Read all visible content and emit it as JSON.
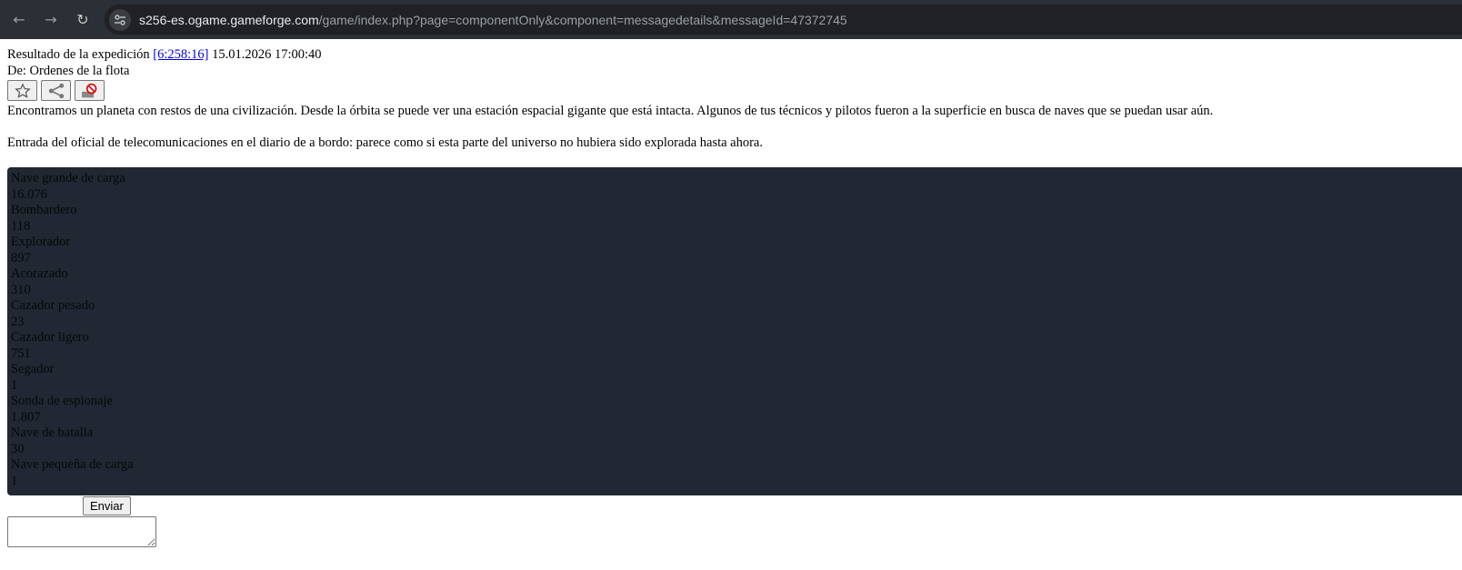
{
  "browser": {
    "url_host": "s256-es.ogame.gameforge.com",
    "url_path": "/game/index.php?page=componentOnly&component=messagedetails&messageId=47372745"
  },
  "message": {
    "title_prefix": "Resultado de la expedición",
    "coords": "[6:258:16]",
    "datetime": "15.01.2026 17:00:40",
    "from": "De: Ordenes de la flota",
    "paragraph1": "Encontramos un planeta con restos de una civilización. Desde la órbita se puede ver una estación espacial gigante que está intacta. Algunos de tus técnicos y pilotos fueron a la superficie en busca de naves que se puedan usar aún.",
    "paragraph2": "Entrada del oficial de telecomunicaciones en el diario de a bordo: parece como si esta parte del universo no hubiera sido explorada hasta ahora."
  },
  "ships": [
    {
      "name": "Nave grande de carga",
      "count": "16.076"
    },
    {
      "name": "Bombardero",
      "count": "118"
    },
    {
      "name": "Explorador",
      "count": "897"
    },
    {
      "name": "Acorazado",
      "count": "310"
    },
    {
      "name": "Cazador pesado",
      "count": "23"
    },
    {
      "name": "Cazador ligero",
      "count": "751"
    },
    {
      "name": "Segador",
      "count": "1"
    },
    {
      "name": "Sonda de espionaje",
      "count": "1.807"
    },
    {
      "name": "Nave de batalla",
      "count": "30"
    },
    {
      "name": "Nave pequeña de carga",
      "count": "1"
    }
  ],
  "form": {
    "send_label": "Enviar"
  }
}
